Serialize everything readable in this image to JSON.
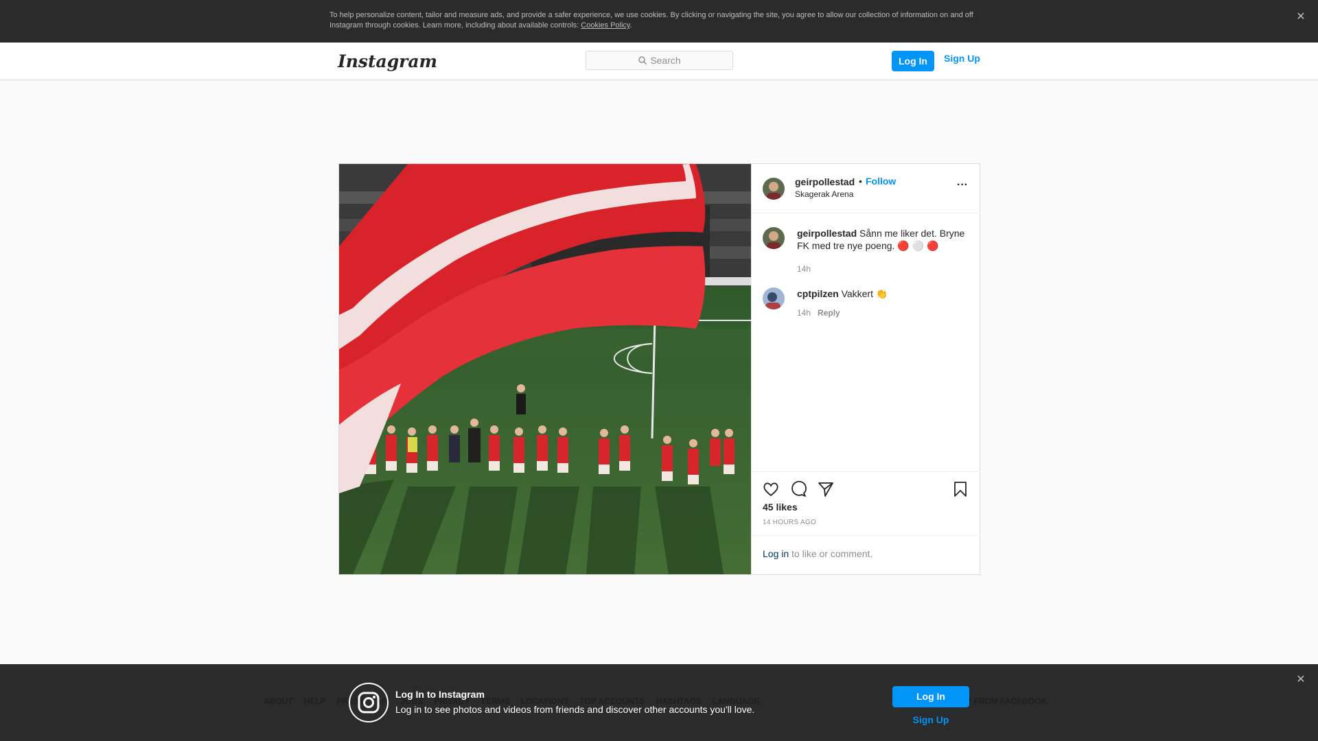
{
  "cookie_banner": {
    "text": "To help personalize content, tailor and measure ads, and provide a safer experience, we use cookies. By clicking or navigating the site, you agree to allow our collection of information on and off Instagram through cookies. Learn more, including about available controls: ",
    "link": "Cookies Policy",
    "period": ".",
    "close_icon": "close-icon"
  },
  "nav": {
    "logo": "Instagram",
    "search_placeholder": "Search",
    "login_label": "Log In",
    "signup_label": "Sign Up"
  },
  "post": {
    "username": "geirpollestad",
    "dot": "•",
    "follow_label": "Follow",
    "location": "Skagerak Arena",
    "more_icon": "more-options-icon",
    "comments": [
      {
        "user": "geirpollestad",
        "text": "Sånn me liker det. Bryne FK med tre nye poeng. 🔴 ⚪ 🔴",
        "time": "14h",
        "reply": ""
      },
      {
        "user": "cptpilzen",
        "text": "Vakkert 👏",
        "time": "14h",
        "reply": "Reply"
      }
    ],
    "likes": "45 likes",
    "posted": "14 HOURS AGO",
    "login_link": "Log in",
    "login_rest": " to like or comment."
  },
  "footer": {
    "links": [
      "ABOUT",
      "HELP",
      "PRESS",
      "API",
      "JOBS",
      "PRIVACY",
      "TERMS",
      "LOCATIONS",
      "TOP ACCOUNTS",
      "HASHTAGS",
      "LANGUAGE"
    ],
    "right": "M FROM FACEBOOK"
  },
  "bottom_bar": {
    "title": "Log In to Instagram",
    "subtitle": "Log in to see photos and videos from friends and discover other accounts you'll love.",
    "login_label": "Log In",
    "signup_label": "Sign Up"
  },
  "colors": {
    "accent": "#0095f6",
    "banner_bg": "#2b2b2b",
    "flag_red": "#d8232a"
  }
}
